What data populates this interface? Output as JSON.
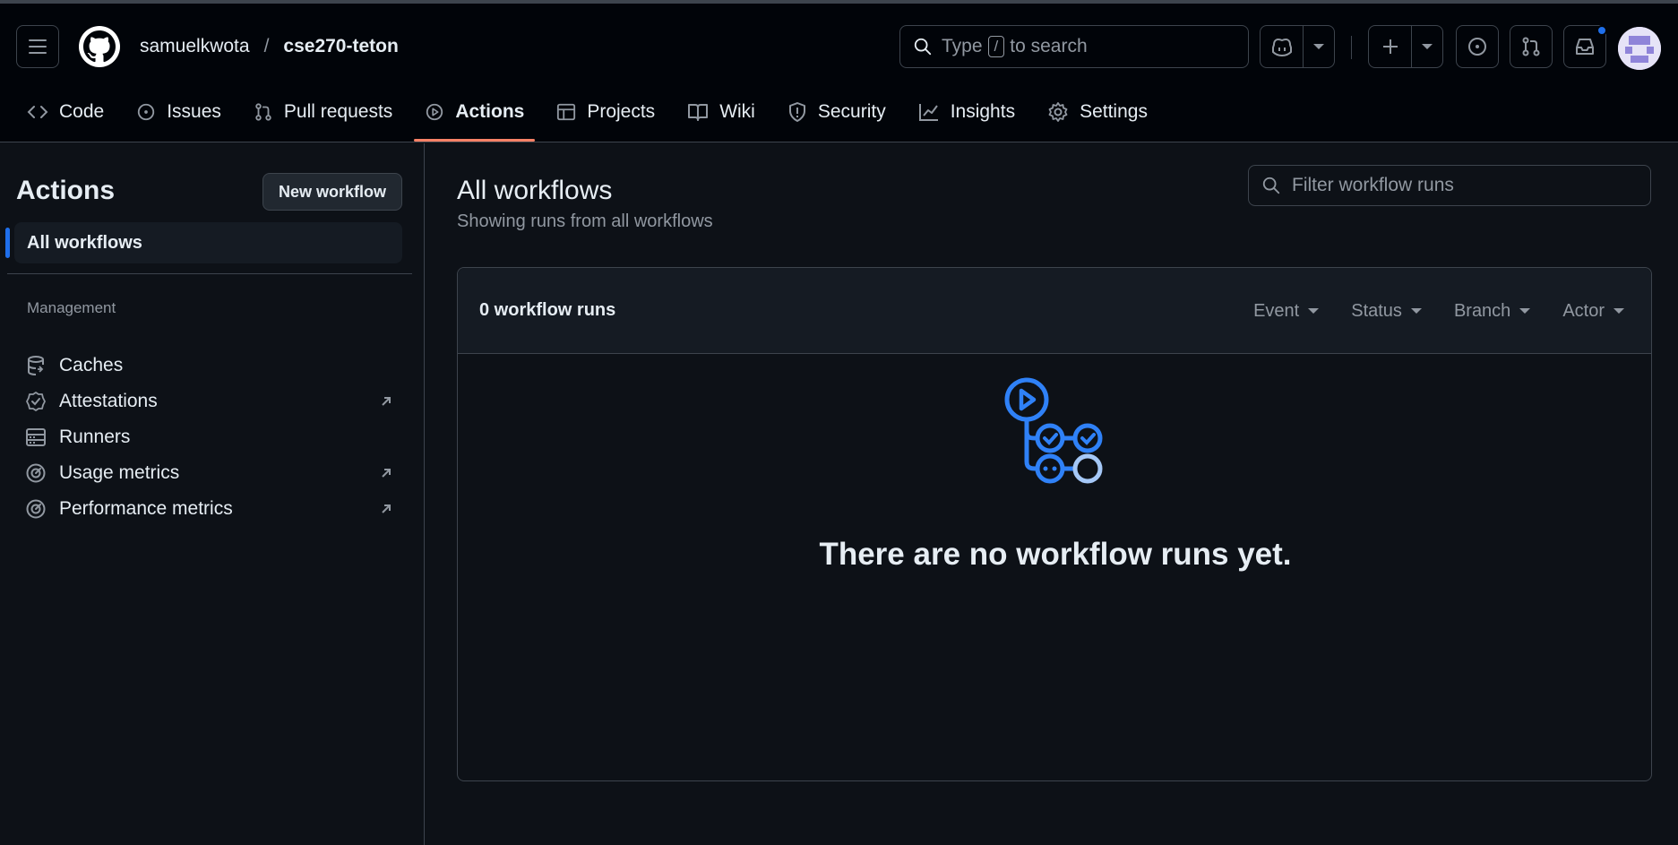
{
  "header": {
    "owner": "samuelkwota",
    "separator": "/",
    "repo": "cse270-teton",
    "search": {
      "prefix": "Type",
      "key": "/",
      "suffix": "to search"
    }
  },
  "tabs": [
    {
      "label": "Code",
      "icon": "code-icon"
    },
    {
      "label": "Issues",
      "icon": "issue-icon"
    },
    {
      "label": "Pull requests",
      "icon": "pull-request-icon"
    },
    {
      "label": "Actions",
      "icon": "play-icon",
      "active": true
    },
    {
      "label": "Projects",
      "icon": "table-icon"
    },
    {
      "label": "Wiki",
      "icon": "book-icon"
    },
    {
      "label": "Security",
      "icon": "shield-icon"
    },
    {
      "label": "Insights",
      "icon": "graph-icon"
    },
    {
      "label": "Settings",
      "icon": "gear-icon"
    }
  ],
  "sidebar": {
    "title": "Actions",
    "new_workflow": "New workflow",
    "all_workflows": "All workflows",
    "section_label": "Management",
    "items": [
      {
        "label": "Caches",
        "icon": "database-icon",
        "external": false
      },
      {
        "label": "Attestations",
        "icon": "verified-icon",
        "external": true
      },
      {
        "label": "Runners",
        "icon": "server-icon",
        "external": false
      },
      {
        "label": "Usage metrics",
        "icon": "meter-icon",
        "external": true
      },
      {
        "label": "Performance metrics",
        "icon": "meter-icon",
        "external": true
      }
    ]
  },
  "main": {
    "title": "All workflows",
    "subtitle": "Showing runs from all workflows",
    "filter_placeholder": "Filter workflow runs",
    "runs_count": "0 workflow runs",
    "filters": [
      "Event",
      "Status",
      "Branch",
      "Actor"
    ],
    "empty_message": "There are no workflow runs yet."
  },
  "colors": {
    "background": "#0d1117",
    "header_background": "#010409",
    "border": "#3d444d",
    "accent_blue": "#1f6feb",
    "active_tab_underline": "#f78166",
    "muted_text": "#9198a1"
  }
}
